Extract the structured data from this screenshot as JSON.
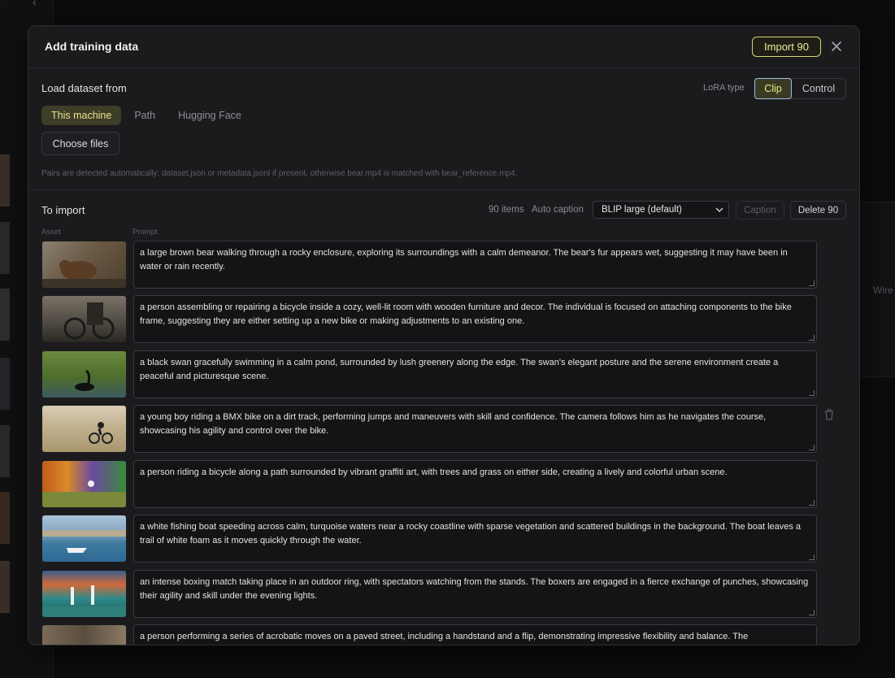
{
  "background": {
    "right_panel_text": "Wire"
  },
  "modal": {
    "title": "Add training data",
    "import_button": "Import 90",
    "close_icon": "close-icon"
  },
  "load": {
    "label": "Load dataset from",
    "lora_type_label": "LoRA type",
    "lora_options": [
      "Clip",
      "Control"
    ],
    "lora_selected": "Clip",
    "sources": [
      "This machine",
      "Path",
      "Hugging Face"
    ],
    "source_selected": "This machine",
    "choose_files": "Choose files",
    "hint": "Pairs are detected automatically: dataset.json or metadata.jsonl if present, otherwise bear.mp4 is matched with bear_reference.mp4."
  },
  "import": {
    "label": "To import",
    "items_count": "90 items",
    "auto_caption_label": "Auto caption",
    "model_selected": "BLIP large (default)",
    "caption_button": "Caption",
    "delete_button": "Delete 90",
    "col_asset": "Asset",
    "col_prompt": "Prompt",
    "rows": [
      {
        "prompt": "a large brown bear walking through a rocky enclosure, exploring its surroundings with a calm demeanor. The bear's fur appears wet, suggesting it may have been in water or rain recently.",
        "thumb_color": "#7d6d58"
      },
      {
        "prompt": "a person assembling or repairing a bicycle inside a cozy, well-lit room with wooden furniture and decor. The individual is focused on attaching components to the bike frame, suggesting they are either setting up a new bike or making adjustments to an existing one.",
        "thumb_color": "#5e5a52"
      },
      {
        "prompt": "a black swan gracefully swimming in a calm pond, surrounded by lush greenery along the edge. The swan's elegant posture and the serene environment create a peaceful and picturesque scene.",
        "thumb_color": "#5d7a3a"
      },
      {
        "prompt": "a young boy riding a BMX bike on a dirt track, performing jumps and maneuvers with skill and confidence. The camera follows him as he navigates the course, showcasing his agility and control over the bike.",
        "thumb_color": "#c7b89a",
        "trash": true
      },
      {
        "prompt": "a person riding a bicycle along a path surrounded by vibrant graffiti art, with trees and grass on either side, creating a lively and colorful urban scene.",
        "thumb_color": "#b25a22"
      },
      {
        "prompt": "a white fishing boat speeding across calm, turquoise waters near a rocky coastline with sparse vegetation and scattered buildings in the background. The boat leaves a trail of white foam as it moves quickly through the water.",
        "thumb_color": "#5b86a8"
      },
      {
        "prompt": "an intense boxing match taking place in an outdoor ring, with spectators watching from the stands. The boxers are engaged in a fierce exchange of punches, showcasing their agility and skill under the evening lights.",
        "thumb_color": "#3a6d7a"
      },
      {
        "prompt": "a person performing a series of acrobatic moves on a paved street, including a handstand and a flip, demonstrating impressive flexibility and balance. The",
        "thumb_color": "#6a5e4e"
      }
    ]
  }
}
